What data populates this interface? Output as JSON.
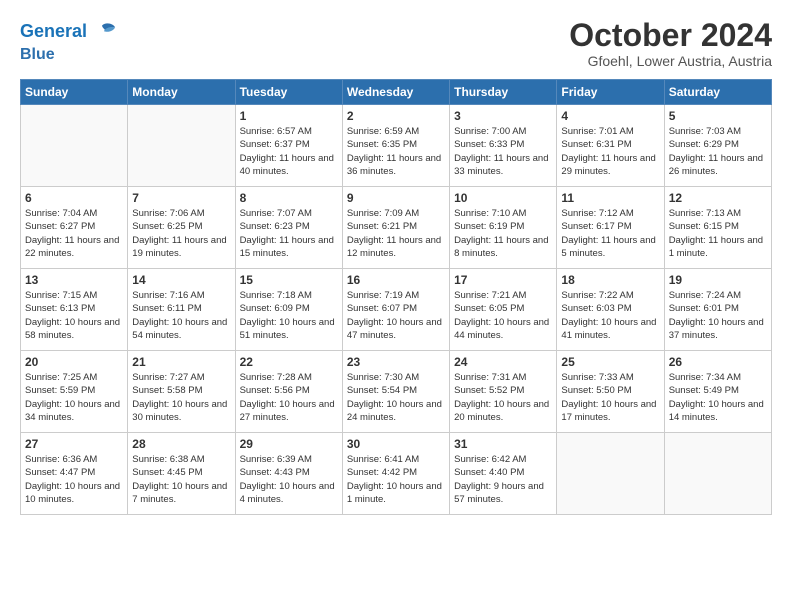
{
  "header": {
    "logo_line1": "General",
    "logo_line2": "Blue",
    "title": "October 2024",
    "subtitle": "Gfoehl, Lower Austria, Austria"
  },
  "weekdays": [
    "Sunday",
    "Monday",
    "Tuesday",
    "Wednesday",
    "Thursday",
    "Friday",
    "Saturday"
  ],
  "weeks": [
    [
      {
        "day": "",
        "info": ""
      },
      {
        "day": "",
        "info": ""
      },
      {
        "day": "1",
        "info": "Sunrise: 6:57 AM\nSunset: 6:37 PM\nDaylight: 11 hours and 40 minutes."
      },
      {
        "day": "2",
        "info": "Sunrise: 6:59 AM\nSunset: 6:35 PM\nDaylight: 11 hours and 36 minutes."
      },
      {
        "day": "3",
        "info": "Sunrise: 7:00 AM\nSunset: 6:33 PM\nDaylight: 11 hours and 33 minutes."
      },
      {
        "day": "4",
        "info": "Sunrise: 7:01 AM\nSunset: 6:31 PM\nDaylight: 11 hours and 29 minutes."
      },
      {
        "day": "5",
        "info": "Sunrise: 7:03 AM\nSunset: 6:29 PM\nDaylight: 11 hours and 26 minutes."
      }
    ],
    [
      {
        "day": "6",
        "info": "Sunrise: 7:04 AM\nSunset: 6:27 PM\nDaylight: 11 hours and 22 minutes."
      },
      {
        "day": "7",
        "info": "Sunrise: 7:06 AM\nSunset: 6:25 PM\nDaylight: 11 hours and 19 minutes."
      },
      {
        "day": "8",
        "info": "Sunrise: 7:07 AM\nSunset: 6:23 PM\nDaylight: 11 hours and 15 minutes."
      },
      {
        "day": "9",
        "info": "Sunrise: 7:09 AM\nSunset: 6:21 PM\nDaylight: 11 hours and 12 minutes."
      },
      {
        "day": "10",
        "info": "Sunrise: 7:10 AM\nSunset: 6:19 PM\nDaylight: 11 hours and 8 minutes."
      },
      {
        "day": "11",
        "info": "Sunrise: 7:12 AM\nSunset: 6:17 PM\nDaylight: 11 hours and 5 minutes."
      },
      {
        "day": "12",
        "info": "Sunrise: 7:13 AM\nSunset: 6:15 PM\nDaylight: 11 hours and 1 minute."
      }
    ],
    [
      {
        "day": "13",
        "info": "Sunrise: 7:15 AM\nSunset: 6:13 PM\nDaylight: 10 hours and 58 minutes."
      },
      {
        "day": "14",
        "info": "Sunrise: 7:16 AM\nSunset: 6:11 PM\nDaylight: 10 hours and 54 minutes."
      },
      {
        "day": "15",
        "info": "Sunrise: 7:18 AM\nSunset: 6:09 PM\nDaylight: 10 hours and 51 minutes."
      },
      {
        "day": "16",
        "info": "Sunrise: 7:19 AM\nSunset: 6:07 PM\nDaylight: 10 hours and 47 minutes."
      },
      {
        "day": "17",
        "info": "Sunrise: 7:21 AM\nSunset: 6:05 PM\nDaylight: 10 hours and 44 minutes."
      },
      {
        "day": "18",
        "info": "Sunrise: 7:22 AM\nSunset: 6:03 PM\nDaylight: 10 hours and 41 minutes."
      },
      {
        "day": "19",
        "info": "Sunrise: 7:24 AM\nSunset: 6:01 PM\nDaylight: 10 hours and 37 minutes."
      }
    ],
    [
      {
        "day": "20",
        "info": "Sunrise: 7:25 AM\nSunset: 5:59 PM\nDaylight: 10 hours and 34 minutes."
      },
      {
        "day": "21",
        "info": "Sunrise: 7:27 AM\nSunset: 5:58 PM\nDaylight: 10 hours and 30 minutes."
      },
      {
        "day": "22",
        "info": "Sunrise: 7:28 AM\nSunset: 5:56 PM\nDaylight: 10 hours and 27 minutes."
      },
      {
        "day": "23",
        "info": "Sunrise: 7:30 AM\nSunset: 5:54 PM\nDaylight: 10 hours and 24 minutes."
      },
      {
        "day": "24",
        "info": "Sunrise: 7:31 AM\nSunset: 5:52 PM\nDaylight: 10 hours and 20 minutes."
      },
      {
        "day": "25",
        "info": "Sunrise: 7:33 AM\nSunset: 5:50 PM\nDaylight: 10 hours and 17 minutes."
      },
      {
        "day": "26",
        "info": "Sunrise: 7:34 AM\nSunset: 5:49 PM\nDaylight: 10 hours and 14 minutes."
      }
    ],
    [
      {
        "day": "27",
        "info": "Sunrise: 6:36 AM\nSunset: 4:47 PM\nDaylight: 10 hours and 10 minutes."
      },
      {
        "day": "28",
        "info": "Sunrise: 6:38 AM\nSunset: 4:45 PM\nDaylight: 10 hours and 7 minutes."
      },
      {
        "day": "29",
        "info": "Sunrise: 6:39 AM\nSunset: 4:43 PM\nDaylight: 10 hours and 4 minutes."
      },
      {
        "day": "30",
        "info": "Sunrise: 6:41 AM\nSunset: 4:42 PM\nDaylight: 10 hours and 1 minute."
      },
      {
        "day": "31",
        "info": "Sunrise: 6:42 AM\nSunset: 4:40 PM\nDaylight: 9 hours and 57 minutes."
      },
      {
        "day": "",
        "info": ""
      },
      {
        "day": "",
        "info": ""
      }
    ]
  ]
}
